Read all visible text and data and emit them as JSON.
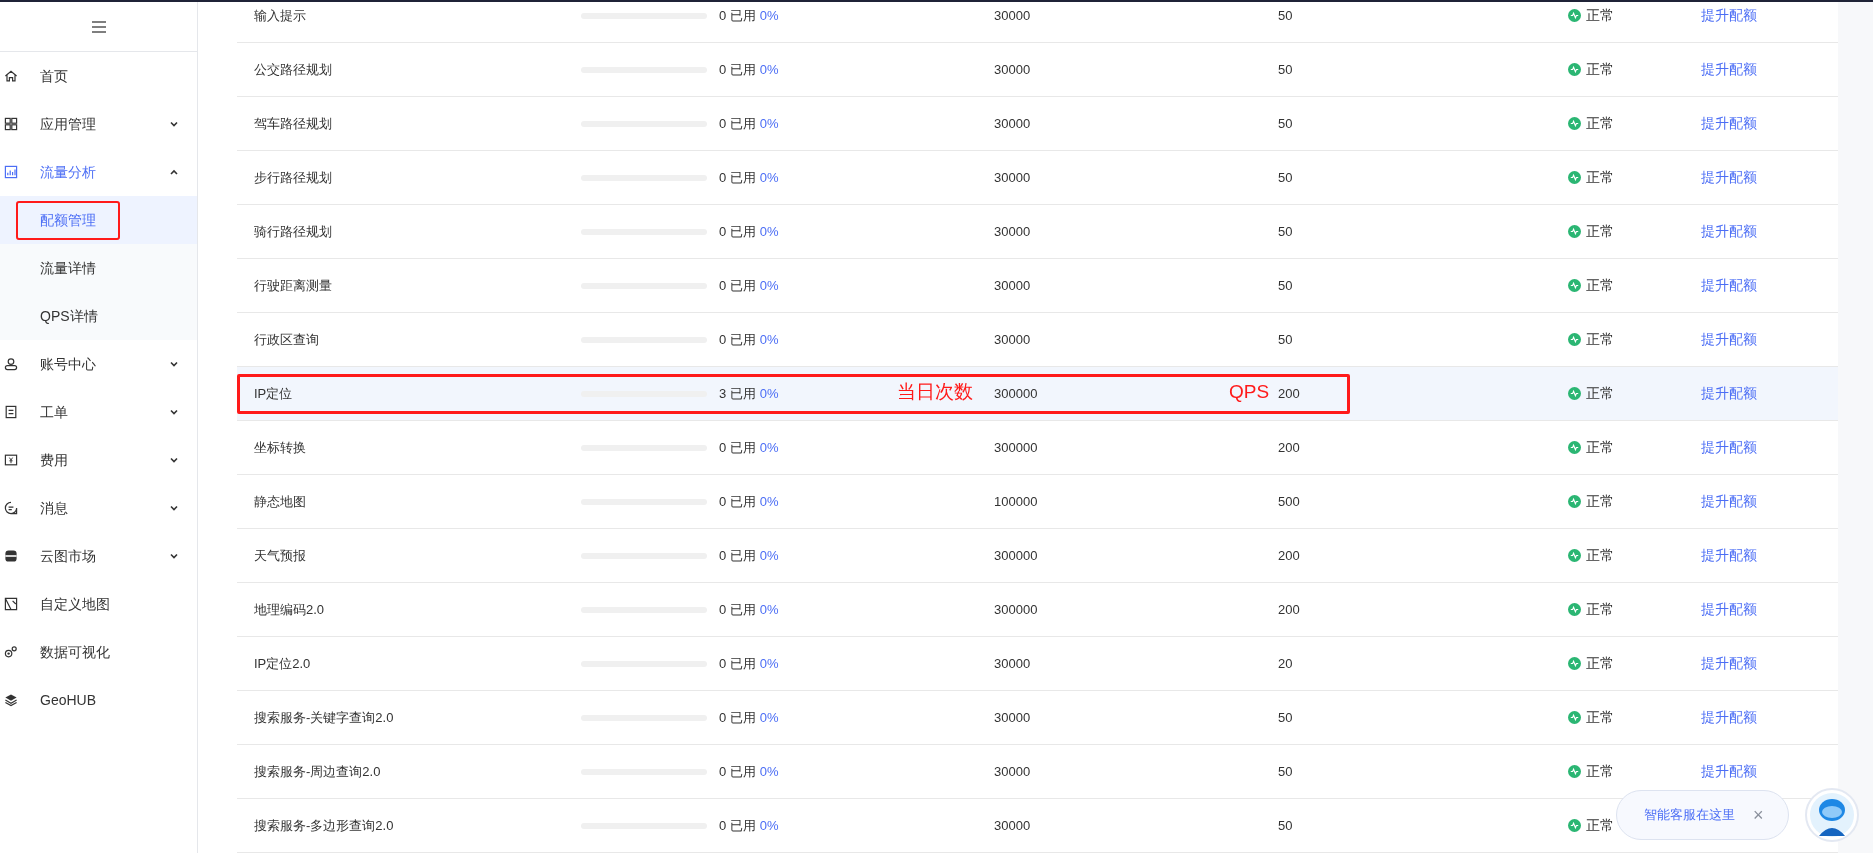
{
  "sidebar": {
    "items": [
      {
        "label": "首页",
        "selected": false
      },
      {
        "label": "应用管理",
        "selected": false,
        "expanded": false
      },
      {
        "label": "流量分析",
        "selected": false,
        "expanded": true,
        "children": [
          {
            "label": "配额管理",
            "selected": true,
            "annotated": true
          },
          {
            "label": "流量详情",
            "selected": false,
            "annotated": false
          },
          {
            "label": "QPS详情",
            "selected": false,
            "annotated": false
          }
        ]
      },
      {
        "label": "账号中心",
        "selected": false,
        "expanded": false
      },
      {
        "label": "工单",
        "selected": false,
        "expanded": false
      },
      {
        "label": "费用",
        "selected": false,
        "expanded": false
      },
      {
        "label": "消息",
        "selected": false,
        "expanded": false
      },
      {
        "label": "云图市场",
        "selected": false,
        "expanded": false
      },
      {
        "label": "自定义地图",
        "selected": false
      },
      {
        "label": "数据可视化",
        "selected": false
      },
      {
        "label": "GeoHUB",
        "selected": false
      }
    ]
  },
  "table": {
    "rows": [
      {
        "name": "输入提示",
        "level": 0,
        "used": "0 已用",
        "percent": "0%",
        "daily": "30000",
        "qps": "50",
        "status": "正常",
        "action": "提升配额",
        "selected": false
      },
      {
        "name": "公交路径规划",
        "level": 0,
        "used": "0 已用",
        "percent": "0%",
        "daily": "30000",
        "qps": "50",
        "status": "正常",
        "action": "提升配额",
        "selected": false
      },
      {
        "name": "驾车路径规划",
        "level": 0,
        "used": "0 已用",
        "percent": "0%",
        "daily": "30000",
        "qps": "50",
        "status": "正常",
        "action": "提升配额",
        "selected": false
      },
      {
        "name": "步行路径规划",
        "level": 0,
        "used": "0 已用",
        "percent": "0%",
        "daily": "30000",
        "qps": "50",
        "status": "正常",
        "action": "提升配额",
        "selected": false
      },
      {
        "name": "骑行路径规划",
        "level": 0,
        "used": "0 已用",
        "percent": "0%",
        "daily": "30000",
        "qps": "50",
        "status": "正常",
        "action": "提升配额",
        "selected": false
      },
      {
        "name": "行驶距离测量",
        "level": 0,
        "used": "0 已用",
        "percent": "0%",
        "daily": "30000",
        "qps": "50",
        "status": "正常",
        "action": "提升配额",
        "selected": false
      },
      {
        "name": "行政区查询",
        "level": 0,
        "used": "0 已用",
        "percent": "0%",
        "daily": "30000",
        "qps": "50",
        "status": "正常",
        "action": "提升配额",
        "selected": false
      },
      {
        "name": "IP定位",
        "level": 0,
        "used": "3 已用",
        "percent": "0%",
        "daily": "300000",
        "qps": "200",
        "status": "正常",
        "action": "提升配额",
        "selected": true,
        "callouts": {
          "daily": "当日次数",
          "qps": "QPS"
        }
      },
      {
        "name": "坐标转换",
        "level": 0,
        "used": "0 已用",
        "percent": "0%",
        "daily": "300000",
        "qps": "200",
        "status": "正常",
        "action": "提升配额",
        "selected": false
      },
      {
        "name": "静态地图",
        "level": 0,
        "used": "0 已用",
        "percent": "0%",
        "daily": "100000",
        "qps": "500",
        "status": "正常",
        "action": "提升配额",
        "selected": false
      },
      {
        "name": "天气预报",
        "level": 0,
        "used": "0 已用",
        "percent": "0%",
        "daily": "300000",
        "qps": "200",
        "status": "正常",
        "action": "提升配额",
        "selected": false
      },
      {
        "name": "地理编码2.0",
        "level": 0,
        "used": "0 已用",
        "percent": "0%",
        "daily": "300000",
        "qps": "200",
        "status": "正常",
        "action": "提升配额",
        "selected": false
      },
      {
        "name": "IP定位2.0",
        "level": 0,
        "used": "0 已用",
        "percent": "0%",
        "daily": "30000",
        "qps": "20",
        "status": "正常",
        "action": "提升配额",
        "selected": false
      },
      {
        "name": "搜索服务-关键字查询2.0",
        "level": 0,
        "used": "0 已用",
        "percent": "0%",
        "daily": "30000",
        "qps": "50",
        "status": "正常",
        "action": "提升配额",
        "selected": false
      },
      {
        "name": "搜索服务-周边查询2.0",
        "level": 0,
        "used": "0 已用",
        "percent": "0%",
        "daily": "30000",
        "qps": "50",
        "status": "正常",
        "action": "提升配额",
        "selected": false
      },
      {
        "name": "搜索服务-多边形查询2.0",
        "level": 0,
        "used": "0 已用",
        "percent": "0%",
        "daily": "30000",
        "qps": "50",
        "status": "正常",
        "selected": false
      }
    ]
  },
  "chat_widget": {
    "message": "智能客服在这里",
    "close": "×"
  }
}
